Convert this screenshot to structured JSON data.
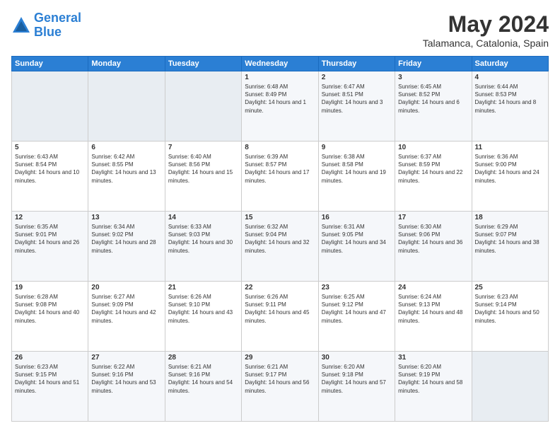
{
  "header": {
    "logo_line1": "General",
    "logo_line2": "Blue",
    "month_year": "May 2024",
    "location": "Talamanca, Catalonia, Spain"
  },
  "days_of_week": [
    "Sunday",
    "Monday",
    "Tuesday",
    "Wednesday",
    "Thursday",
    "Friday",
    "Saturday"
  ],
  "weeks": [
    [
      {
        "num": "",
        "sunrise": "",
        "sunset": "",
        "daylight": "",
        "empty": true
      },
      {
        "num": "",
        "sunrise": "",
        "sunset": "",
        "daylight": "",
        "empty": true
      },
      {
        "num": "",
        "sunrise": "",
        "sunset": "",
        "daylight": "",
        "empty": true
      },
      {
        "num": "1",
        "sunrise": "Sunrise: 6:48 AM",
        "sunset": "Sunset: 8:49 PM",
        "daylight": "Daylight: 14 hours and 1 minute."
      },
      {
        "num": "2",
        "sunrise": "Sunrise: 6:47 AM",
        "sunset": "Sunset: 8:51 PM",
        "daylight": "Daylight: 14 hours and 3 minutes."
      },
      {
        "num": "3",
        "sunrise": "Sunrise: 6:45 AM",
        "sunset": "Sunset: 8:52 PM",
        "daylight": "Daylight: 14 hours and 6 minutes."
      },
      {
        "num": "4",
        "sunrise": "Sunrise: 6:44 AM",
        "sunset": "Sunset: 8:53 PM",
        "daylight": "Daylight: 14 hours and 8 minutes."
      }
    ],
    [
      {
        "num": "5",
        "sunrise": "Sunrise: 6:43 AM",
        "sunset": "Sunset: 8:54 PM",
        "daylight": "Daylight: 14 hours and 10 minutes."
      },
      {
        "num": "6",
        "sunrise": "Sunrise: 6:42 AM",
        "sunset": "Sunset: 8:55 PM",
        "daylight": "Daylight: 14 hours and 13 minutes."
      },
      {
        "num": "7",
        "sunrise": "Sunrise: 6:40 AM",
        "sunset": "Sunset: 8:56 PM",
        "daylight": "Daylight: 14 hours and 15 minutes."
      },
      {
        "num": "8",
        "sunrise": "Sunrise: 6:39 AM",
        "sunset": "Sunset: 8:57 PM",
        "daylight": "Daylight: 14 hours and 17 minutes."
      },
      {
        "num": "9",
        "sunrise": "Sunrise: 6:38 AM",
        "sunset": "Sunset: 8:58 PM",
        "daylight": "Daylight: 14 hours and 19 minutes."
      },
      {
        "num": "10",
        "sunrise": "Sunrise: 6:37 AM",
        "sunset": "Sunset: 8:59 PM",
        "daylight": "Daylight: 14 hours and 22 minutes."
      },
      {
        "num": "11",
        "sunrise": "Sunrise: 6:36 AM",
        "sunset": "Sunset: 9:00 PM",
        "daylight": "Daylight: 14 hours and 24 minutes."
      }
    ],
    [
      {
        "num": "12",
        "sunrise": "Sunrise: 6:35 AM",
        "sunset": "Sunset: 9:01 PM",
        "daylight": "Daylight: 14 hours and 26 minutes."
      },
      {
        "num": "13",
        "sunrise": "Sunrise: 6:34 AM",
        "sunset": "Sunset: 9:02 PM",
        "daylight": "Daylight: 14 hours and 28 minutes."
      },
      {
        "num": "14",
        "sunrise": "Sunrise: 6:33 AM",
        "sunset": "Sunset: 9:03 PM",
        "daylight": "Daylight: 14 hours and 30 minutes."
      },
      {
        "num": "15",
        "sunrise": "Sunrise: 6:32 AM",
        "sunset": "Sunset: 9:04 PM",
        "daylight": "Daylight: 14 hours and 32 minutes."
      },
      {
        "num": "16",
        "sunrise": "Sunrise: 6:31 AM",
        "sunset": "Sunset: 9:05 PM",
        "daylight": "Daylight: 14 hours and 34 minutes."
      },
      {
        "num": "17",
        "sunrise": "Sunrise: 6:30 AM",
        "sunset": "Sunset: 9:06 PM",
        "daylight": "Daylight: 14 hours and 36 minutes."
      },
      {
        "num": "18",
        "sunrise": "Sunrise: 6:29 AM",
        "sunset": "Sunset: 9:07 PM",
        "daylight": "Daylight: 14 hours and 38 minutes."
      }
    ],
    [
      {
        "num": "19",
        "sunrise": "Sunrise: 6:28 AM",
        "sunset": "Sunset: 9:08 PM",
        "daylight": "Daylight: 14 hours and 40 minutes."
      },
      {
        "num": "20",
        "sunrise": "Sunrise: 6:27 AM",
        "sunset": "Sunset: 9:09 PM",
        "daylight": "Daylight: 14 hours and 42 minutes."
      },
      {
        "num": "21",
        "sunrise": "Sunrise: 6:26 AM",
        "sunset": "Sunset: 9:10 PM",
        "daylight": "Daylight: 14 hours and 43 minutes."
      },
      {
        "num": "22",
        "sunrise": "Sunrise: 6:26 AM",
        "sunset": "Sunset: 9:11 PM",
        "daylight": "Daylight: 14 hours and 45 minutes."
      },
      {
        "num": "23",
        "sunrise": "Sunrise: 6:25 AM",
        "sunset": "Sunset: 9:12 PM",
        "daylight": "Daylight: 14 hours and 47 minutes."
      },
      {
        "num": "24",
        "sunrise": "Sunrise: 6:24 AM",
        "sunset": "Sunset: 9:13 PM",
        "daylight": "Daylight: 14 hours and 48 minutes."
      },
      {
        "num": "25",
        "sunrise": "Sunrise: 6:23 AM",
        "sunset": "Sunset: 9:14 PM",
        "daylight": "Daylight: 14 hours and 50 minutes."
      }
    ],
    [
      {
        "num": "26",
        "sunrise": "Sunrise: 6:23 AM",
        "sunset": "Sunset: 9:15 PM",
        "daylight": "Daylight: 14 hours and 51 minutes."
      },
      {
        "num": "27",
        "sunrise": "Sunrise: 6:22 AM",
        "sunset": "Sunset: 9:16 PM",
        "daylight": "Daylight: 14 hours and 53 minutes."
      },
      {
        "num": "28",
        "sunrise": "Sunrise: 6:21 AM",
        "sunset": "Sunset: 9:16 PM",
        "daylight": "Daylight: 14 hours and 54 minutes."
      },
      {
        "num": "29",
        "sunrise": "Sunrise: 6:21 AM",
        "sunset": "Sunset: 9:17 PM",
        "daylight": "Daylight: 14 hours and 56 minutes."
      },
      {
        "num": "30",
        "sunrise": "Sunrise: 6:20 AM",
        "sunset": "Sunset: 9:18 PM",
        "daylight": "Daylight: 14 hours and 57 minutes."
      },
      {
        "num": "31",
        "sunrise": "Sunrise: 6:20 AM",
        "sunset": "Sunset: 9:19 PM",
        "daylight": "Daylight: 14 hours and 58 minutes."
      },
      {
        "num": "",
        "sunrise": "",
        "sunset": "",
        "daylight": "",
        "empty": true
      }
    ]
  ]
}
